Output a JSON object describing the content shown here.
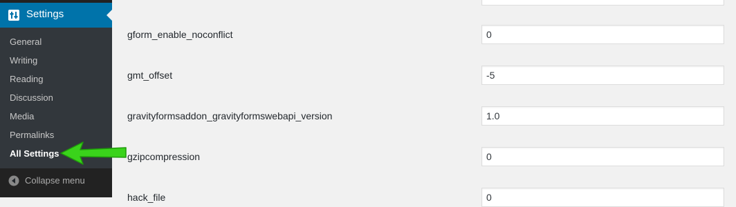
{
  "sidebar": {
    "header_label": "Settings",
    "items": [
      {
        "label": "General"
      },
      {
        "label": "Writing"
      },
      {
        "label": "Reading"
      },
      {
        "label": "Discussion"
      },
      {
        "label": "Media"
      },
      {
        "label": "Permalinks"
      },
      {
        "label": "All Settings",
        "current": true
      }
    ],
    "collapse_label": "Collapse menu",
    "colors": {
      "accent": "#0073aa",
      "menu_bg": "#23282d",
      "submenu_bg": "#32373c"
    }
  },
  "options": [
    {
      "name": "",
      "value": ""
    },
    {
      "name": "gform_enable_noconflict",
      "value": "0"
    },
    {
      "name": "gmt_offset",
      "value": "-5"
    },
    {
      "name": "gravityformsaddon_gravityformswebapi_version",
      "value": "1.0"
    },
    {
      "name": "gzipcompression",
      "value": "0"
    },
    {
      "name": "hack_file",
      "value": "0"
    }
  ],
  "annotation": {
    "type": "green-arrow",
    "points_to": "All Settings",
    "color": "#3ad31b"
  }
}
